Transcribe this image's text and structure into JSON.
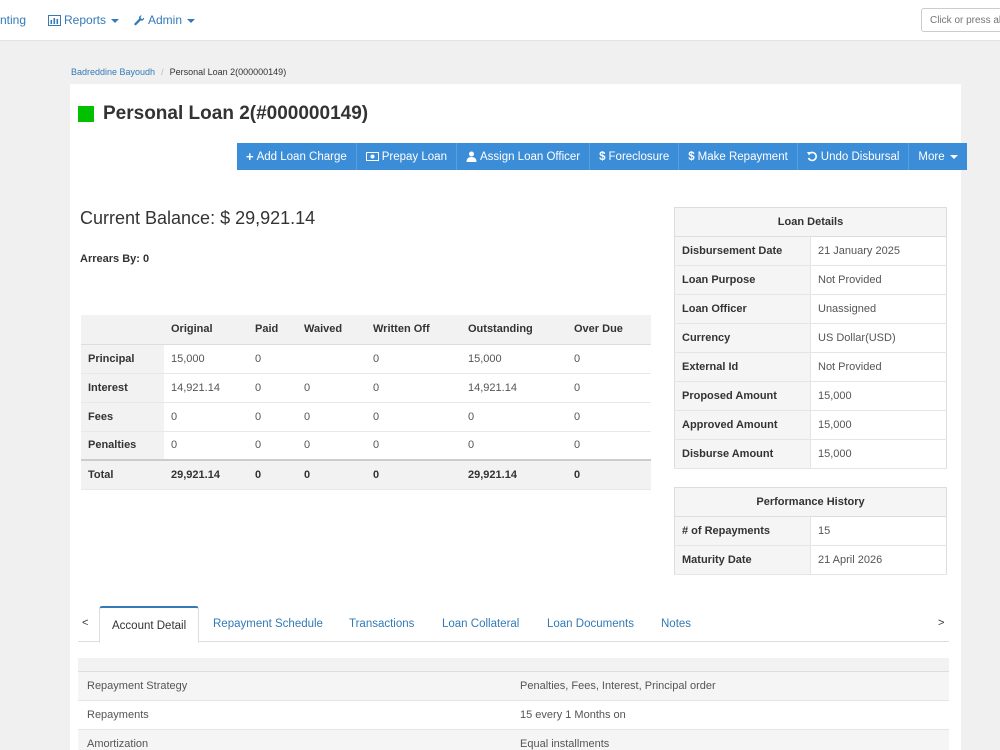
{
  "nav": {
    "accounting": "nting",
    "reports": "Reports",
    "admin": "Admin",
    "search_placeholder": "Click or press alt + x to search"
  },
  "breadcrumb": {
    "client": "Badreddine Bayoudh",
    "current": "Personal Loan 2(000000149)"
  },
  "loan": {
    "title": "Personal Loan 2(#000000149)",
    "status_color": "#00c000",
    "current_balance": "Current Balance: $ 29,921.14",
    "arrears": "Arrears By: 0"
  },
  "actions": [
    {
      "icon": "+",
      "label": "Add Loan Charge"
    },
    {
      "icon": "▣",
      "label": "Prepay Loan"
    },
    {
      "icon": "👤",
      "label": "Assign Loan Officer"
    },
    {
      "icon": "$",
      "label": "Foreclosure"
    },
    {
      "icon": "$",
      "label": "Make Repayment"
    },
    {
      "icon": "↺",
      "label": "Undo Disbursal"
    },
    {
      "icon": "",
      "label": "More"
    }
  ],
  "summary": {
    "columns": [
      "",
      "Original",
      "Paid",
      "Waived",
      "Written Off",
      "Outstanding",
      "Over Due"
    ],
    "rows": [
      [
        "Principal",
        "15,000",
        "0",
        "",
        "0",
        "15,000",
        "0"
      ],
      [
        "Interest",
        "14,921.14",
        "0",
        "0",
        "0",
        "14,921.14",
        "0"
      ],
      [
        "Fees",
        "0",
        "0",
        "0",
        "0",
        "0",
        "0"
      ],
      [
        "Penalties",
        "0",
        "0",
        "0",
        "0",
        "0",
        "0"
      ],
      [
        "Total",
        "29,921.14",
        "0",
        "0",
        "0",
        "29,921.14",
        "0"
      ]
    ]
  },
  "loan_details": {
    "title": "Loan Details",
    "rows": [
      [
        "Disbursement Date",
        "21 January 2025"
      ],
      [
        "Loan Purpose",
        "Not Provided"
      ],
      [
        "Loan Officer",
        "Unassigned"
      ],
      [
        "Currency",
        "US Dollar(USD)"
      ],
      [
        "External Id",
        "Not Provided"
      ],
      [
        "Proposed Amount",
        "15,000"
      ],
      [
        "Approved Amount",
        "15,000"
      ],
      [
        "Disburse Amount",
        "15,000"
      ]
    ]
  },
  "performance": {
    "title": "Performance History",
    "rows": [
      [
        "# of Repayments",
        "15"
      ],
      [
        "Maturity Date",
        "21 April 2026"
      ]
    ]
  },
  "tabs": {
    "prev": "<",
    "next": ">",
    "items": [
      "Account Detail",
      "Repayment Schedule",
      "Transactions",
      "Loan Collateral",
      "Loan Documents",
      "Notes"
    ]
  },
  "account_detail": [
    [
      "Repayment Strategy",
      "Penalties, Fees, Interest, Principal order"
    ],
    [
      "Repayments",
      "15 every 1 Months on"
    ],
    [
      "Amortization",
      "Equal installments"
    ]
  ],
  "colors": {
    "primary": "#3c8dd8",
    "link": "#337ab7",
    "status_active": "#00c000"
  }
}
